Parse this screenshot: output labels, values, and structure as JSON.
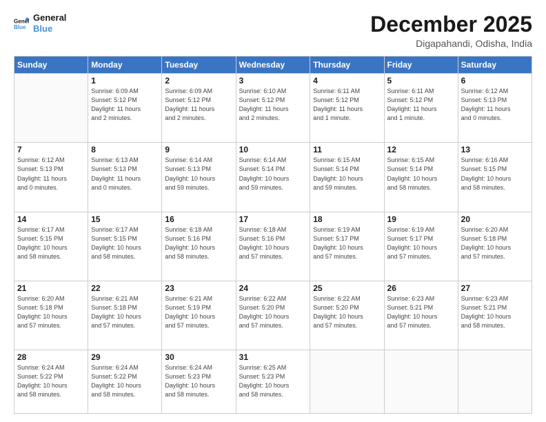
{
  "header": {
    "logo_line1": "General",
    "logo_line2": "Blue",
    "title": "December 2025",
    "subtitle": "Digapahandi, Odisha, India"
  },
  "weekdays": [
    "Sunday",
    "Monday",
    "Tuesday",
    "Wednesday",
    "Thursday",
    "Friday",
    "Saturday"
  ],
  "weeks": [
    [
      {
        "day": "",
        "info": ""
      },
      {
        "day": "1",
        "info": "Sunrise: 6:09 AM\nSunset: 5:12 PM\nDaylight: 11 hours\nand 2 minutes."
      },
      {
        "day": "2",
        "info": "Sunrise: 6:09 AM\nSunset: 5:12 PM\nDaylight: 11 hours\nand 2 minutes."
      },
      {
        "day": "3",
        "info": "Sunrise: 6:10 AM\nSunset: 5:12 PM\nDaylight: 11 hours\nand 2 minutes."
      },
      {
        "day": "4",
        "info": "Sunrise: 6:11 AM\nSunset: 5:12 PM\nDaylight: 11 hours\nand 1 minute."
      },
      {
        "day": "5",
        "info": "Sunrise: 6:11 AM\nSunset: 5:12 PM\nDaylight: 11 hours\nand 1 minute."
      },
      {
        "day": "6",
        "info": "Sunrise: 6:12 AM\nSunset: 5:13 PM\nDaylight: 11 hours\nand 0 minutes."
      }
    ],
    [
      {
        "day": "7",
        "info": "Sunrise: 6:12 AM\nSunset: 5:13 PM\nDaylight: 11 hours\nand 0 minutes."
      },
      {
        "day": "8",
        "info": "Sunrise: 6:13 AM\nSunset: 5:13 PM\nDaylight: 11 hours\nand 0 minutes."
      },
      {
        "day": "9",
        "info": "Sunrise: 6:14 AM\nSunset: 5:13 PM\nDaylight: 10 hours\nand 59 minutes."
      },
      {
        "day": "10",
        "info": "Sunrise: 6:14 AM\nSunset: 5:14 PM\nDaylight: 10 hours\nand 59 minutes."
      },
      {
        "day": "11",
        "info": "Sunrise: 6:15 AM\nSunset: 5:14 PM\nDaylight: 10 hours\nand 59 minutes."
      },
      {
        "day": "12",
        "info": "Sunrise: 6:15 AM\nSunset: 5:14 PM\nDaylight: 10 hours\nand 58 minutes."
      },
      {
        "day": "13",
        "info": "Sunrise: 6:16 AM\nSunset: 5:15 PM\nDaylight: 10 hours\nand 58 minutes."
      }
    ],
    [
      {
        "day": "14",
        "info": "Sunrise: 6:17 AM\nSunset: 5:15 PM\nDaylight: 10 hours\nand 58 minutes."
      },
      {
        "day": "15",
        "info": "Sunrise: 6:17 AM\nSunset: 5:15 PM\nDaylight: 10 hours\nand 58 minutes."
      },
      {
        "day": "16",
        "info": "Sunrise: 6:18 AM\nSunset: 5:16 PM\nDaylight: 10 hours\nand 58 minutes."
      },
      {
        "day": "17",
        "info": "Sunrise: 6:18 AM\nSunset: 5:16 PM\nDaylight: 10 hours\nand 57 minutes."
      },
      {
        "day": "18",
        "info": "Sunrise: 6:19 AM\nSunset: 5:17 PM\nDaylight: 10 hours\nand 57 minutes."
      },
      {
        "day": "19",
        "info": "Sunrise: 6:19 AM\nSunset: 5:17 PM\nDaylight: 10 hours\nand 57 minutes."
      },
      {
        "day": "20",
        "info": "Sunrise: 6:20 AM\nSunset: 5:18 PM\nDaylight: 10 hours\nand 57 minutes."
      }
    ],
    [
      {
        "day": "21",
        "info": "Sunrise: 6:20 AM\nSunset: 5:18 PM\nDaylight: 10 hours\nand 57 minutes."
      },
      {
        "day": "22",
        "info": "Sunrise: 6:21 AM\nSunset: 5:18 PM\nDaylight: 10 hours\nand 57 minutes."
      },
      {
        "day": "23",
        "info": "Sunrise: 6:21 AM\nSunset: 5:19 PM\nDaylight: 10 hours\nand 57 minutes."
      },
      {
        "day": "24",
        "info": "Sunrise: 6:22 AM\nSunset: 5:20 PM\nDaylight: 10 hours\nand 57 minutes."
      },
      {
        "day": "25",
        "info": "Sunrise: 6:22 AM\nSunset: 5:20 PM\nDaylight: 10 hours\nand 57 minutes."
      },
      {
        "day": "26",
        "info": "Sunrise: 6:23 AM\nSunset: 5:21 PM\nDaylight: 10 hours\nand 57 minutes."
      },
      {
        "day": "27",
        "info": "Sunrise: 6:23 AM\nSunset: 5:21 PM\nDaylight: 10 hours\nand 58 minutes."
      }
    ],
    [
      {
        "day": "28",
        "info": "Sunrise: 6:24 AM\nSunset: 5:22 PM\nDaylight: 10 hours\nand 58 minutes."
      },
      {
        "day": "29",
        "info": "Sunrise: 6:24 AM\nSunset: 5:22 PM\nDaylight: 10 hours\nand 58 minutes."
      },
      {
        "day": "30",
        "info": "Sunrise: 6:24 AM\nSunset: 5:23 PM\nDaylight: 10 hours\nand 58 minutes."
      },
      {
        "day": "31",
        "info": "Sunrise: 6:25 AM\nSunset: 5:23 PM\nDaylight: 10 hours\nand 58 minutes."
      },
      {
        "day": "",
        "info": ""
      },
      {
        "day": "",
        "info": ""
      },
      {
        "day": "",
        "info": ""
      }
    ]
  ]
}
